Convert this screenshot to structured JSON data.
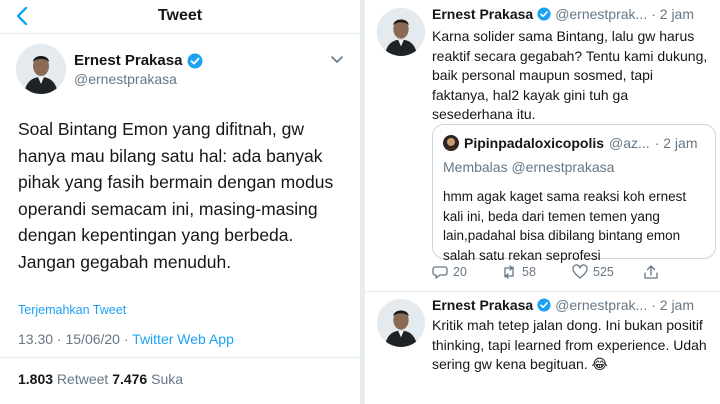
{
  "colors": {
    "accent": "#1da1f2",
    "muted": "#657786",
    "text": "#14171a",
    "border": "#e6ecf0"
  },
  "header": {
    "title": "Tweet",
    "back_icon": "chevron-left-icon"
  },
  "tweet": {
    "author_name": "Ernest Prakasa",
    "author_handle": "@ernestprakasa",
    "text": "Soal Bintang Emon yang difitnah, gw hanya mau bilang satu hal: ada banyak pihak yang fasih bermain dengan modus operandi semacam ini, masing-masing dengan kepentingan yang berbeda. Jangan gegabah menuduh.",
    "translate_label": "Terjemahkan Tweet",
    "time": "13.30 · 15/06/20 · ",
    "app": "Twitter Web App",
    "retweets_count": "1.803",
    "retweets_label": " Retweet ",
    "likes_count": "7.476",
    "likes_label": " Suka"
  },
  "replies": [
    {
      "name": "Ernest Prakasa",
      "handle": "@ernestprak...",
      "time": "· 2 jam",
      "text": "Karna solider sama Bintang, lalu gw harus reaktif secara gegabah? Tentu kami dukung, baik personal maupun sosmed, tapi faktanya, hal2 kayak gini tuh ga sesederhana itu.",
      "quote": {
        "name": "Pipinpadaloxicopolis",
        "handle": "@az...",
        "time": "· 2 jam",
        "replying": "Membalas @ernestprakasa",
        "text": "hmm agak kaget sama reaksi koh ernest kali ini, beda dari temen temen yang lain,padahal bisa dibilang bintang emon salah satu rekan seprofesi"
      },
      "actions": {
        "replies": "20",
        "retweets": "58",
        "likes": "525"
      }
    },
    {
      "name": "Ernest Prakasa",
      "handle": "@ernestprak...",
      "time": "· 2 jam",
      "text": "Kritik mah tetep jalan dong. Ini bukan positif thinking, tapi learned from experience. Udah sering gw kena begituan. 😂"
    }
  ]
}
